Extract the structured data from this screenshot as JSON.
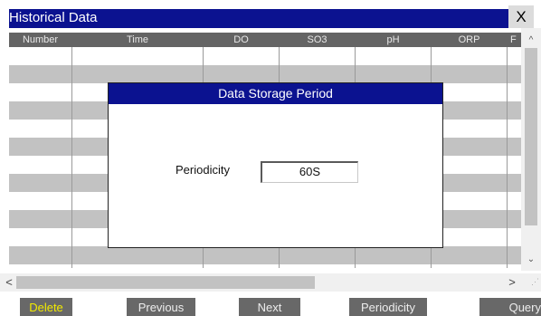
{
  "window": {
    "title": "Historical Data",
    "close_label": "X"
  },
  "table": {
    "columns": [
      "Number",
      "Time",
      "DO",
      "SO3",
      "pH",
      "ORP",
      "F"
    ],
    "rows": []
  },
  "scrollbars": {
    "up_arrow": "^",
    "down_arrow": "⌄",
    "left_arrow": "<",
    "right_arrow": ">"
  },
  "buttons": {
    "delete": "Delete",
    "previous": "Previous",
    "next": "Next",
    "periodicity": "Periodicity",
    "query": "Query"
  },
  "dialog": {
    "title": "Data Storage Period",
    "periodicity_label": "Periodicity",
    "periodicity_value": "60S"
  },
  "colors": {
    "title_bar": "#0b1290",
    "header_row": "#646464",
    "alt_row": "#c2c2c2",
    "button_bg": "#686868",
    "delete_text": "#f2ea00"
  }
}
